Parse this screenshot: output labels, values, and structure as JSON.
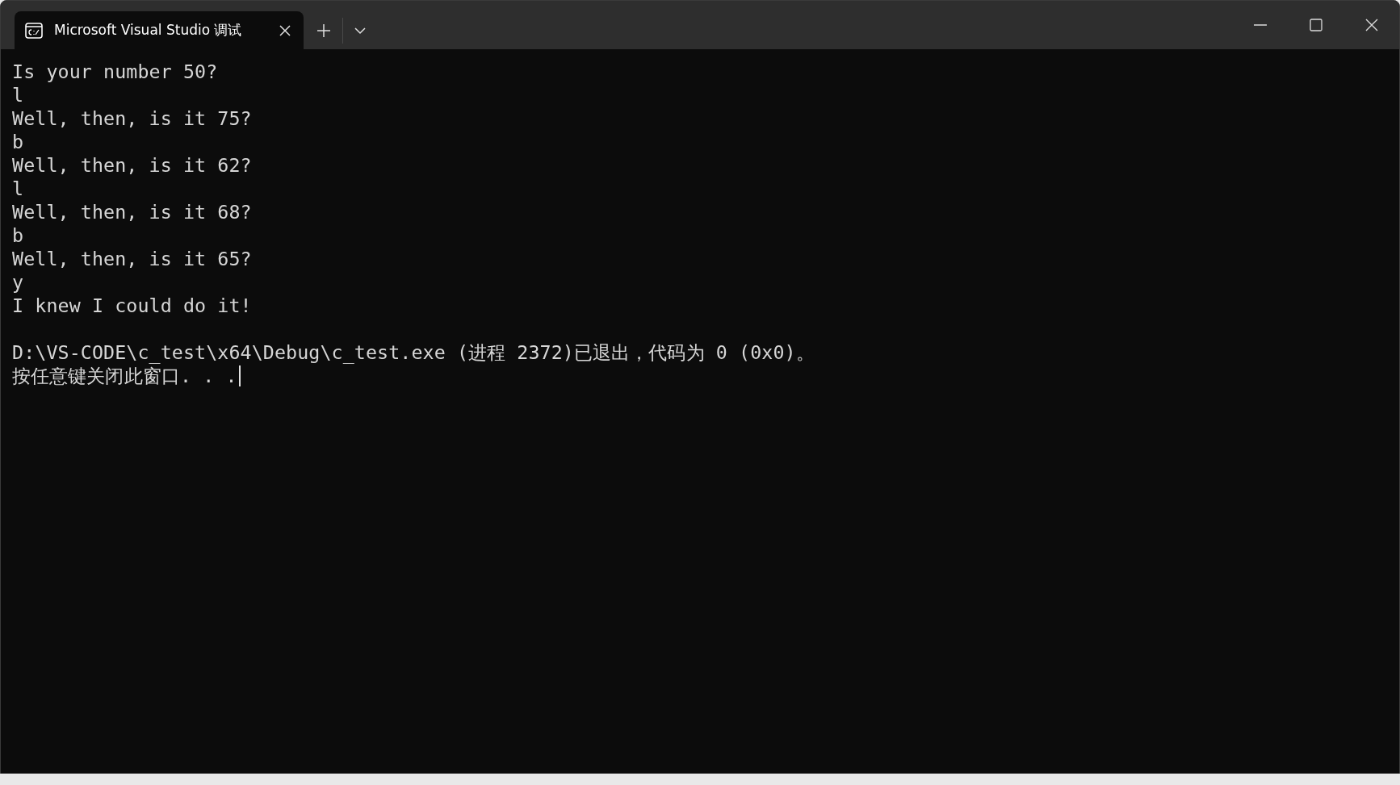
{
  "window": {
    "tab_title": "Microsoft Visual Studio 调试"
  },
  "console": {
    "blocks": [
      [
        "Is your number 50?",
        "l",
        "Well, then, is it 75?",
        "b",
        "Well, then, is it 62?",
        "l",
        "Well, then, is it 68?",
        "b",
        "Well, then, is it 65?",
        "y",
        "I knew I could do it!"
      ],
      [
        "D:\\VS-CODE\\c_test\\x64\\Debug\\c_test.exe (进程 2372)已退出，代码为 0 (0x0)。",
        "按任意键关闭此窗口. . ."
      ]
    ]
  }
}
